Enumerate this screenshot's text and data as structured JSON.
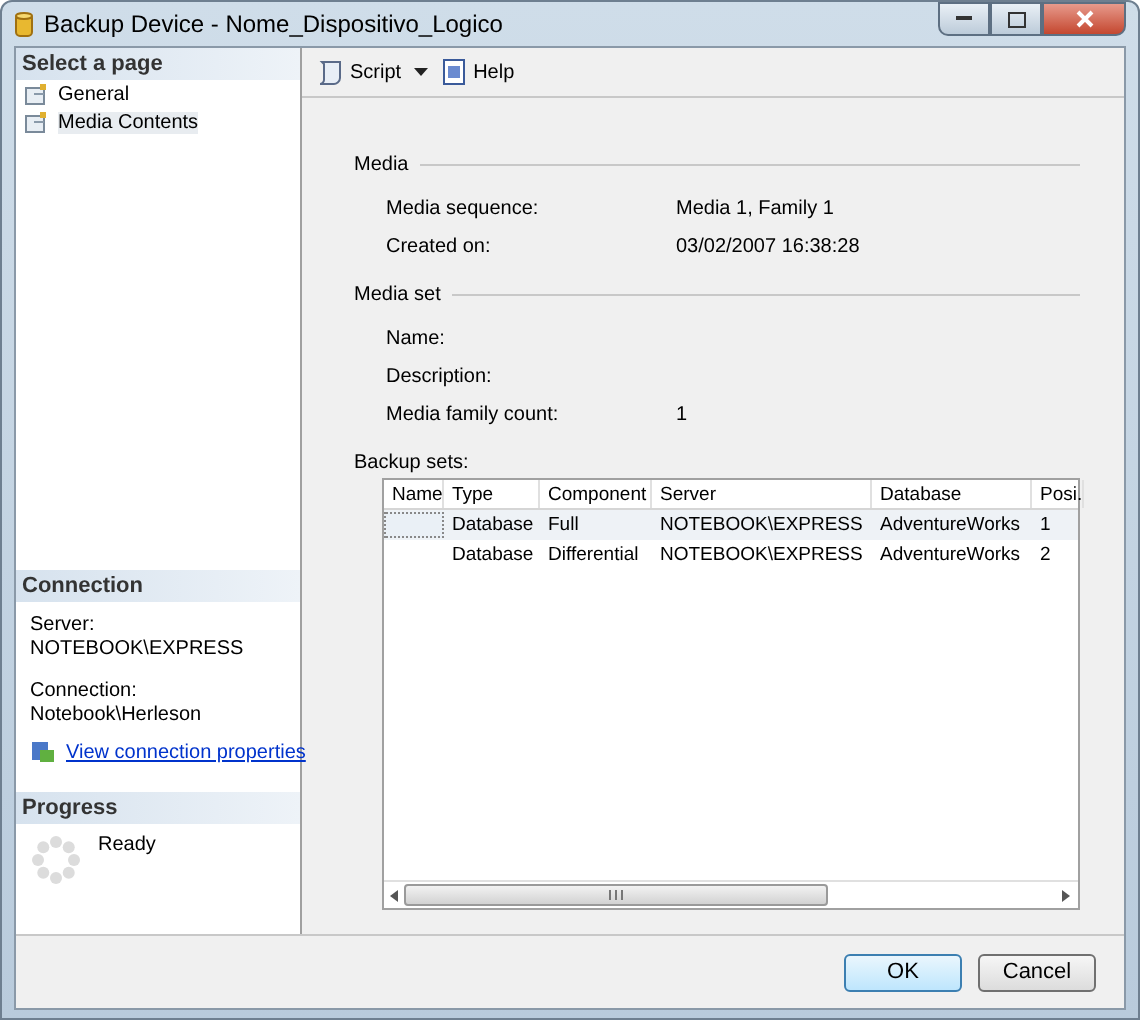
{
  "window": {
    "title": "Backup Device - Nome_Dispositivo_Logico"
  },
  "sidebar": {
    "header": "Select a page",
    "items": [
      {
        "label": "General",
        "selected": false
      },
      {
        "label": "Media Contents",
        "selected": true
      }
    ]
  },
  "connection": {
    "header": "Connection",
    "server_label": "Server:",
    "server": "NOTEBOOK\\EXPRESS",
    "connection_label": "Connection:",
    "connection": "Notebook\\Herleson",
    "link": "View connection properties"
  },
  "progress": {
    "header": "Progress",
    "status": "Ready"
  },
  "toolbar": {
    "script": "Script",
    "help": "Help"
  },
  "sections": [
    {
      "title": "Media",
      "fields": [
        {
          "label": "Media sequence:",
          "value": "Media 1, Family 1"
        },
        {
          "label": "Created on:",
          "value": "03/02/2007 16:38:28"
        }
      ]
    },
    {
      "title": "Media set",
      "fields": [
        {
          "label": "Name:"
        },
        {
          "label": "Description:"
        },
        {
          "label": "Media family count:",
          "value": "1"
        }
      ]
    }
  ],
  "backup_sets": {
    "label": "Backup sets:",
    "columns": [
      "Name",
      "Type",
      "Component",
      "Server",
      "Database",
      "Posi."
    ],
    "rows": [
      {
        "cells": [
          "",
          "Database",
          "Full",
          "NOTEBOOK\\EXPRESS",
          "AdventureWorks",
          "1"
        ],
        "selected": true
      },
      {
        "cells": [
          "",
          "Database",
          "Differential",
          "NOTEBOOK\\EXPRESS",
          "AdventureWorks",
          "2"
        ],
        "selected": false
      }
    ]
  },
  "buttons": [
    "OK",
    "Cancel"
  ]
}
